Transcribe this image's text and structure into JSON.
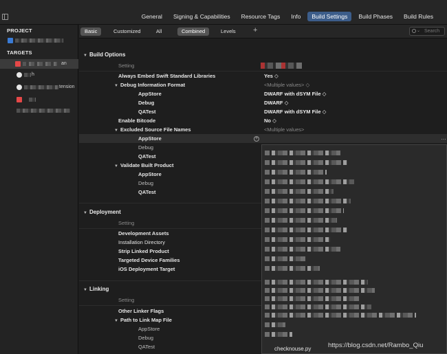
{
  "tabs": [
    {
      "label": "General",
      "active": false
    },
    {
      "label": "Signing & Capabilities",
      "active": false
    },
    {
      "label": "Resource Tags",
      "active": false
    },
    {
      "label": "Info",
      "active": false
    },
    {
      "label": "Build Settings",
      "active": true
    },
    {
      "label": "Build Phases",
      "active": false
    },
    {
      "label": "Build Rules",
      "active": false
    }
  ],
  "navigator": {
    "project_header": "PROJECT",
    "targets_header": "TARGETS",
    "target_label_1": "an",
    "target_label_2": "h",
    "target_label_3": "tension"
  },
  "filter": {
    "basic": "Basic",
    "customized": "Customized",
    "all": "All",
    "combined": "Combined",
    "levels": "Levels",
    "search_placeholder": "Search"
  },
  "build_options": {
    "title": "Build Options",
    "setting_header": "Setting",
    "embed_swift": {
      "label": "Always Embed Swift Standard Libraries",
      "value": "Yes ◇"
    },
    "debug_format": {
      "label": "Debug Information Format",
      "value": "<Multiple values> ◇"
    },
    "appstore_format": {
      "label": "AppStore",
      "value": "DWARF with dSYM File ◇"
    },
    "debug_format_debug": {
      "label": "Debug",
      "value": "DWARF ◇"
    },
    "qatest_format": {
      "label": "QATest",
      "value": "DWARF with dSYM File ◇"
    },
    "enable_bitcode": {
      "label": "Enable Bitcode",
      "value": "No ◇"
    },
    "excluded_names": {
      "label": "Excluded Source File Names",
      "value": "<Multiple values>"
    },
    "excluded_appstore": {
      "label": "AppStore",
      "value": ""
    },
    "excluded_debug": {
      "label": "Debug",
      "value": ""
    },
    "excluded_qatest": {
      "label": "QATest",
      "value": ""
    },
    "validate_product": {
      "label": "Validate Built Product",
      "value": ""
    },
    "validate_appstore": {
      "label": "AppStore",
      "value": ""
    },
    "validate_debug": {
      "label": "Debug",
      "value": ""
    },
    "validate_qatest": {
      "label": "QATest",
      "value": ""
    }
  },
  "deployment": {
    "title": "Deployment",
    "setting_header": "Setting",
    "dev_assets": "Development Assets",
    "install_dir": "Installation Directory",
    "strip_product": "Strip Linked Product",
    "device_families": "Targeted Device Families",
    "ios_target": "iOS Deployment Target"
  },
  "linking": {
    "title": "Linking",
    "setting_header": "Setting",
    "other_flags": "Other Linker Flags",
    "map_file": "Path to Link Map File",
    "map_appstore": "AppStore",
    "map_debug": "Debug",
    "map_qatest": "QATest"
  },
  "popover": {
    "file": "checknouse.py"
  },
  "watermark": "https://blog.csdn.net/Rambo_Qiu"
}
